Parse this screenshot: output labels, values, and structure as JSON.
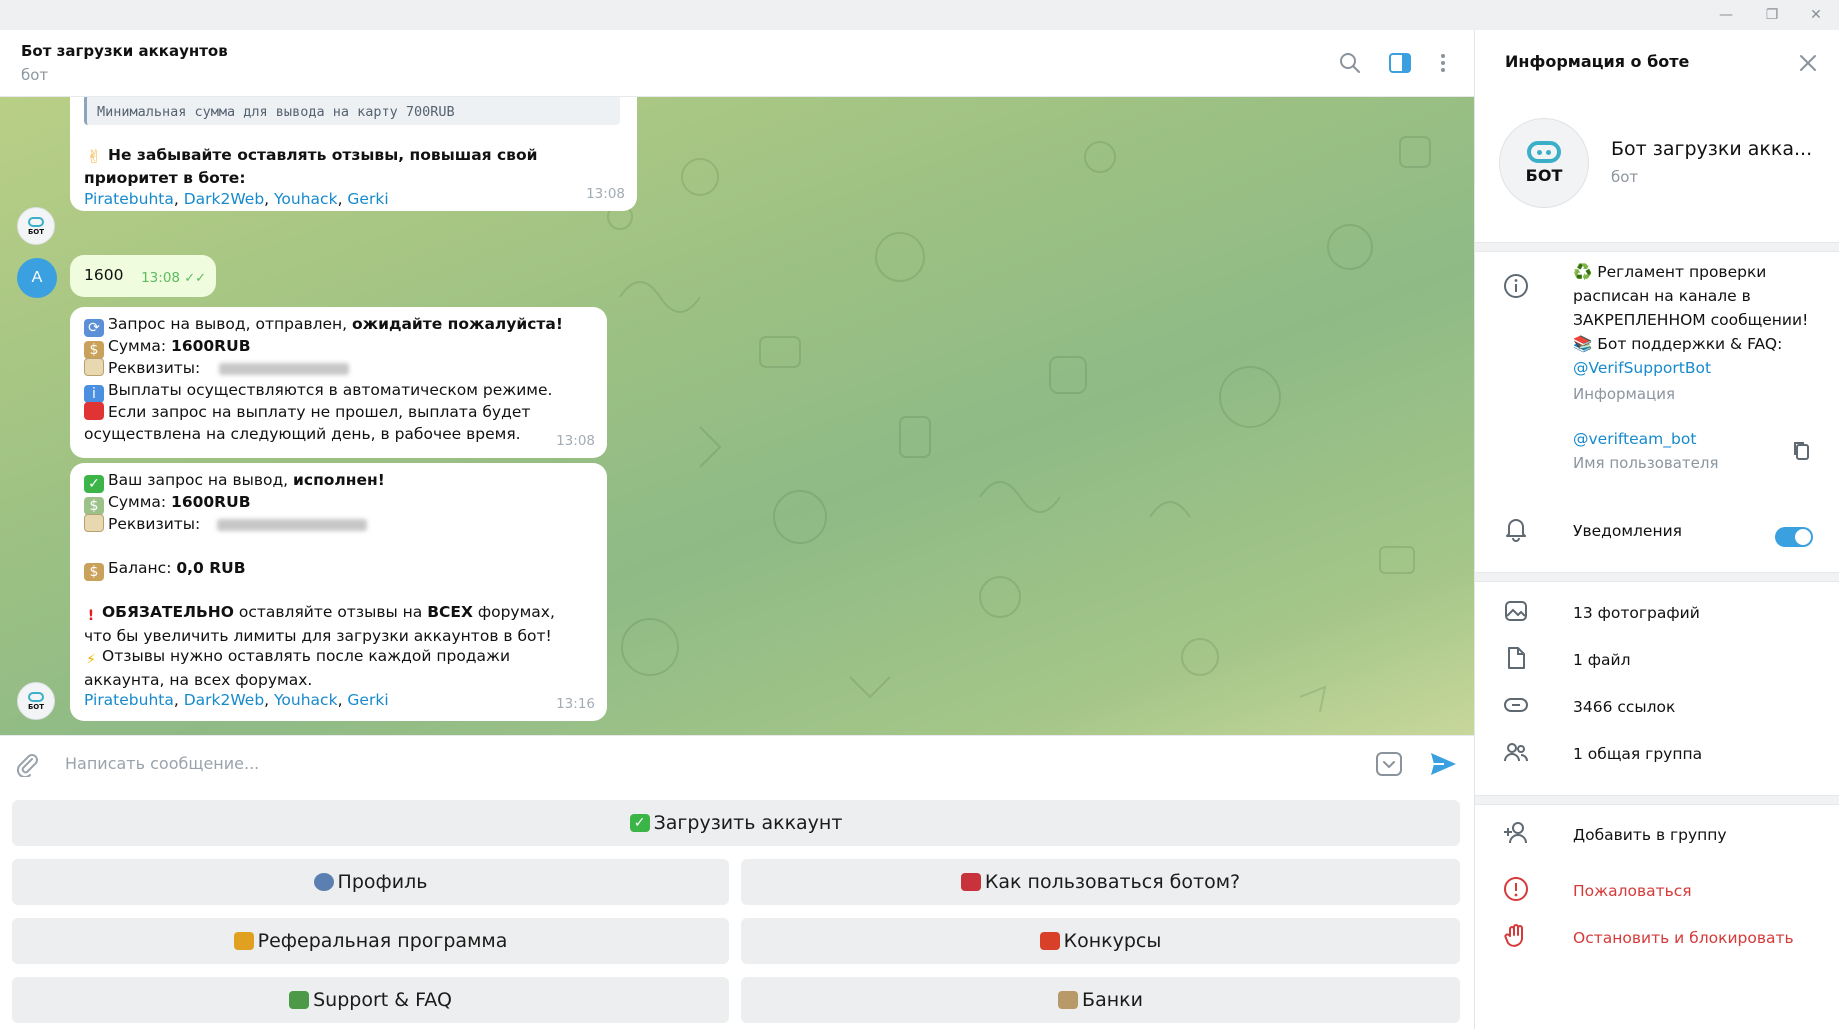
{
  "window": {
    "minimize": "—",
    "restore": "❐",
    "close": "✕"
  },
  "header": {
    "title": "Бот загрузки аккаунтов",
    "subtitle": "бот"
  },
  "messages": {
    "m1": {
      "quote": "Минимальная сумма для вывода на карту 700RUB",
      "emoji": "✌",
      "text_bold": "Не забывайте оставлять отзывы, повышая свой приоритет в боте:",
      "links": [
        "Piratebuhta",
        "Dark2Web",
        "Youhack",
        "Gerki"
      ],
      "sep": ", ",
      "time": "13:08"
    },
    "m2": {
      "text": "1600",
      "time": "13:08",
      "check": "✓✓"
    },
    "m3": {
      "line1_pre": "Запрос на вывод,  отправлен, ",
      "line1_bold": "ожидайте пожалуйста!",
      "line2_pre": "Сумма: ",
      "line2_bold": "1600RUB",
      "line3": "Реквизиты:",
      "line4": "Выплаты осуществляются в автоматическом режиме.",
      "line5": "Если запрос на выплату не прошел, выплата будет осуществлена на следующий день, в рабочее время.",
      "time": "13:08"
    },
    "m4": {
      "line1_pre": "Ваш запрос на вывод, ",
      "line1_bold": "исполнен!",
      "line2_pre": "Сумма: ",
      "line2_bold": "1600RUB",
      "line3": "Реквизиты:",
      "balance_pre": "Баланс: ",
      "balance_bold": "0,0 RUB",
      "warn_bold1": "ОБЯЗАТЕЛЬНО",
      "warn_mid": " оставляйте отзывы на ",
      "warn_bold2": "ВСЕХ",
      "warn_post": " форумах, что бы увеличить лимиты для загрузки аккаунтов в бот!",
      "reviews": "Отзывы нужно оставлять после каждой продажи аккаунта, на всех форумах.",
      "links": [
        "Piratebuhta",
        "Dark2Web",
        "Youhack",
        "Gerki"
      ],
      "sep": ", ",
      "time": "13:16"
    }
  },
  "avatars": {
    "bot_label": "БОТ",
    "user_letter": "A"
  },
  "composer": {
    "placeholder": "Написать сообщение..."
  },
  "keyboard": {
    "upload": "Загрузить аккаунт",
    "profile": "Профиль",
    "howto": "Как пользоваться ботом?",
    "referral": "Реферальная программа",
    "contests": "Конкурсы",
    "support": "Support & FAQ",
    "banks": "Банки"
  },
  "panel": {
    "title": "Информация о боте",
    "name": "Бот загрузки акка...",
    "subtitle": "бот",
    "avatar_label": "БОТ",
    "info_line1": "♻️ Регламент проверки расписан на канале в ЗАКРЕПЛЕННОМ сообщении!",
    "info_line2": "📚 Бот поддержки & FAQ:",
    "info_link": "@VerifSupportBot",
    "info_caption": "Информация",
    "username": "@verifteam_bot",
    "username_caption": "Имя пользователя",
    "notifications": "Уведомления",
    "photos": "13 фотографий",
    "files": "1 файл",
    "links": "3466 ссылок",
    "groups": "1 общая группа",
    "add_to_group": "Добавить в группу",
    "report": "Пожаловаться",
    "block": "Остановить и блокировать"
  },
  "colors": {
    "accent": "#3aa0e0",
    "link": "#168acd",
    "danger": "#d63a3a"
  }
}
